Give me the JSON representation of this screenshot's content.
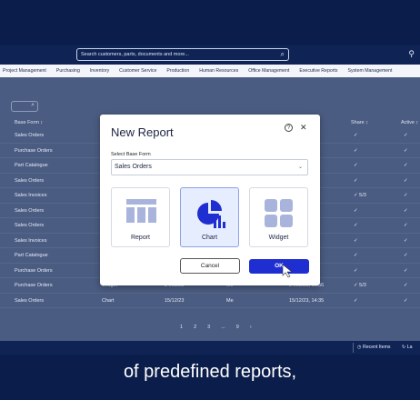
{
  "topbar": {
    "search_placeholder": "Search customers, parts, documents and more..."
  },
  "nav": [
    "Project Management",
    "Purchasing",
    "Inventory",
    "Customer Service",
    "Production",
    "Human Resources",
    "Office Management",
    "Executive Reports",
    "System Management"
  ],
  "list": {
    "headers": {
      "base_form": "Base Form ↕",
      "shared": "Share ↕",
      "active": "Active ↕"
    },
    "rows": [
      {
        "base_form": "Sales Orders",
        "type": "",
        "date": "",
        "owner": "",
        "modified": "26",
        "shared": "✓",
        "active": "✓"
      },
      {
        "base_form": "Purchase Orders",
        "type": "",
        "date": "",
        "owner": "",
        "modified": "42",
        "shared": "✓",
        "active": "✓"
      },
      {
        "base_form": "Part Catalogue",
        "type": "",
        "date": "",
        "owner": "",
        "modified": "54",
        "shared": "✓",
        "active": "✓"
      },
      {
        "base_form": "Sales Orders",
        "type": "",
        "date": "",
        "owner": "",
        "modified": "12",
        "shared": "✓",
        "active": "✓"
      },
      {
        "base_form": "Sales Invoices",
        "type": "",
        "date": "",
        "owner": "",
        "modified": "30",
        "shared": "✓ 5/3",
        "active": "✓"
      },
      {
        "base_form": "Sales Orders",
        "type": "",
        "date": "",
        "owner": "",
        "modified": "07",
        "shared": "✓",
        "active": "✓"
      },
      {
        "base_form": "Sales Orders",
        "type": "",
        "date": "",
        "owner": "",
        "modified": "21",
        "shared": "✓",
        "active": "✓"
      },
      {
        "base_form": "Sales Invoices",
        "type": "",
        "date": "",
        "owner": "",
        "modified": "33",
        "shared": "✓",
        "active": "✓"
      },
      {
        "base_form": "Part Catalogue",
        "type": "",
        "date": "",
        "owner": "",
        "modified": "14",
        "shared": "✓",
        "active": "✓"
      },
      {
        "base_form": "Purchase Orders",
        "type": "",
        "date": "",
        "owner": "",
        "modified": "18",
        "shared": "✓",
        "active": "✓"
      },
      {
        "base_form": "Purchase Orders",
        "type": "Widget",
        "date": "24/05/23",
        "owner": "Me",
        "modified": "24/05/23, 16:56",
        "shared": "✓ 5/3",
        "active": "✓"
      },
      {
        "base_form": "Sales Orders",
        "type": "Chart",
        "date": "15/12/23",
        "owner": "Me",
        "modified": "15/12/23, 14:35",
        "shared": "✓",
        "active": "✓"
      }
    ],
    "pager": [
      "1",
      "2",
      "3",
      "...",
      "9",
      "›"
    ]
  },
  "bottombar": {
    "recent_items": "Recent Items",
    "layout": "La"
  },
  "modal": {
    "title": "New Report",
    "field_label": "Select Base Form",
    "selected_value": "Sales Orders",
    "tiles": [
      "Report",
      "Chart",
      "Widget"
    ],
    "selected_tile": "Chart",
    "cancel": "Cancel",
    "ok": "OK"
  },
  "caption": "of predefined reports,",
  "colors": {
    "accent": "#1f2ed1",
    "navy": "#0b1d4a",
    "tile_selected": "#e6edff"
  }
}
